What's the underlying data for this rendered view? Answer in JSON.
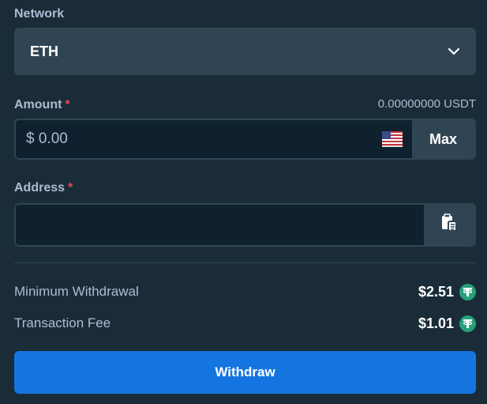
{
  "network": {
    "label": "Network",
    "selected": "ETH"
  },
  "amount": {
    "label": "Amount",
    "required_mark": "*",
    "balance": "0.00000000 USDT",
    "value": "$ 0.00",
    "currency_flag": "us-flag-icon",
    "max_label": "Max"
  },
  "address": {
    "label": "Address",
    "required_mark": "*",
    "value": "",
    "paste_icon": "clipboard-icon"
  },
  "info": {
    "min_withdrawal_label": "Minimum Withdrawal",
    "min_withdrawal_value": "$2.51",
    "fee_label": "Transaction Fee",
    "fee_value": "$1.01",
    "coin_icon": "tether-icon"
  },
  "withdraw_button": "Withdraw",
  "colors": {
    "background": "#1a2c38",
    "input_bg": "#0f212e",
    "control_bg": "#2f4553",
    "accent": "#1475e1",
    "required": "#ed4163",
    "tether": "#26a17b"
  }
}
